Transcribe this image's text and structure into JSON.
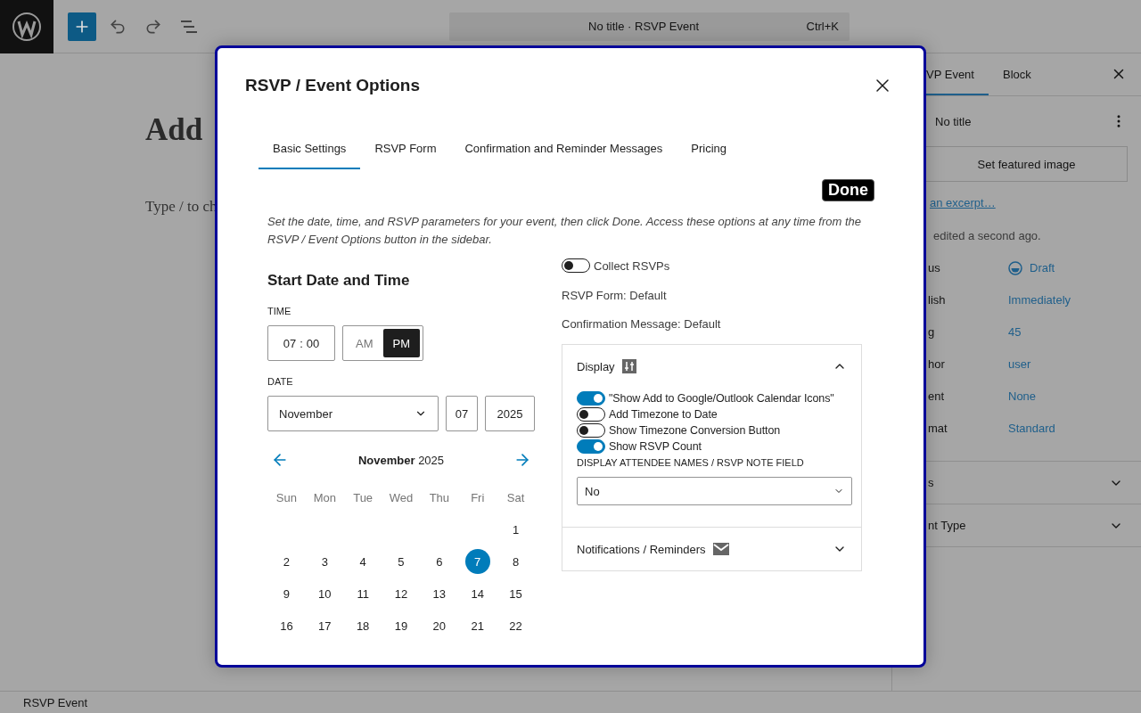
{
  "topbar": {
    "command_title": "No title · RSVP Event",
    "shortcut": "Ctrl+K"
  },
  "editor": {
    "title_fragment": "Add",
    "body_fragment": "Type / to ch"
  },
  "sidebar": {
    "tabs": [
      {
        "label": "VP Event",
        "selected": true
      },
      {
        "label": "Block",
        "selected": false
      }
    ],
    "post_title": "No title",
    "featured_button": "Set featured image",
    "excerpt_link": "an excerpt…",
    "last_edited": "edited a second ago.",
    "fields": [
      {
        "label": "us",
        "value": "Draft",
        "kind": "status"
      },
      {
        "label": "lish",
        "value": "Immediately",
        "kind": "link"
      },
      {
        "label": "g",
        "value": "45",
        "kind": "link"
      },
      {
        "label": "hor",
        "value": "user",
        "kind": "link"
      },
      {
        "label": "ent",
        "value": "None",
        "kind": "link"
      },
      {
        "label": "mat",
        "value": "Standard",
        "kind": "link"
      }
    ],
    "panels": [
      {
        "label": "s",
        "expanded": false
      },
      {
        "label": "nt Type",
        "expanded": false
      }
    ]
  },
  "status_bar": "RSVP Event",
  "modal": {
    "title": "RSVP / Event Options",
    "tabs": [
      {
        "label": "Basic Settings",
        "selected": true
      },
      {
        "label": "RSVP Form",
        "selected": false
      },
      {
        "label": "Confirmation and Reminder Messages",
        "selected": false
      },
      {
        "label": "Pricing",
        "selected": false
      }
    ],
    "done_button": "Done",
    "intro": "Set the date, time, and RSVP parameters for your event, then click Done. Access these options at any time from the RSVP / Event Options button in the sidebar.",
    "start": {
      "heading": "Start Date and Time",
      "time_label": "TIME",
      "hour": "07",
      "separator": ":",
      "minute": "00",
      "meridiem": [
        {
          "label": "AM",
          "selected": false
        },
        {
          "label": "PM",
          "selected": true
        }
      ],
      "date_label": "DATE",
      "month": "November",
      "day": "07",
      "year": "2025",
      "calendar": {
        "month_title": "November",
        "year": "2025",
        "weekdays": [
          "Sun",
          "Mon",
          "Tue",
          "Wed",
          "Thu",
          "Fri",
          "Sat"
        ],
        "weeks": [
          {
            "partial": true,
            "days": [
              {
                "day": "1",
                "selected": false
              }
            ]
          },
          {
            "days": [
              {
                "day": "2",
                "selected": false
              },
              {
                "day": "3",
                "selected": false
              },
              {
                "day": "4",
                "selected": false
              },
              {
                "day": "5",
                "selected": false
              },
              {
                "day": "6",
                "selected": false
              },
              {
                "day": "7",
                "selected": true
              },
              {
                "day": "8",
                "selected": false
              }
            ]
          },
          {
            "days": [
              {
                "day": "9",
                "selected": false
              },
              {
                "day": "10",
                "selected": false
              },
              {
                "day": "11",
                "selected": false
              },
              {
                "day": "12",
                "selected": false
              },
              {
                "day": "13",
                "selected": false
              },
              {
                "day": "14",
                "selected": false
              },
              {
                "day": "15",
                "selected": false
              }
            ]
          },
          {
            "days": [
              {
                "day": "16",
                "selected": false
              },
              {
                "day": "17",
                "selected": false
              },
              {
                "day": "18",
                "selected": false
              },
              {
                "day": "19",
                "selected": false
              },
              {
                "day": "20",
                "selected": false
              },
              {
                "day": "21",
                "selected": false
              },
              {
                "day": "22",
                "selected": false
              }
            ]
          }
        ]
      }
    },
    "collect": {
      "label": "Collect RSVPs",
      "on": false
    },
    "rsvp_form": "RSVP Form: Default",
    "confirmation": "Confirmation Message: Default",
    "display": {
      "title": "Display",
      "expanded": true,
      "toggles": [
        {
          "label": "\"Show Add to Google/Outlook Calendar Icons\"",
          "on": true
        },
        {
          "label": "Add Timezone to Date",
          "on": false
        },
        {
          "label": "Show Timezone Conversion Button",
          "on": false
        },
        {
          "label": "Show RSVP Count",
          "on": true
        }
      ],
      "attendee_label": "DISPLAY ATTENDEE NAMES / RSVP NOTE FIELD",
      "attendee_value": "No"
    },
    "notifications": {
      "title": "Notifications / Reminders",
      "expanded": false
    }
  }
}
